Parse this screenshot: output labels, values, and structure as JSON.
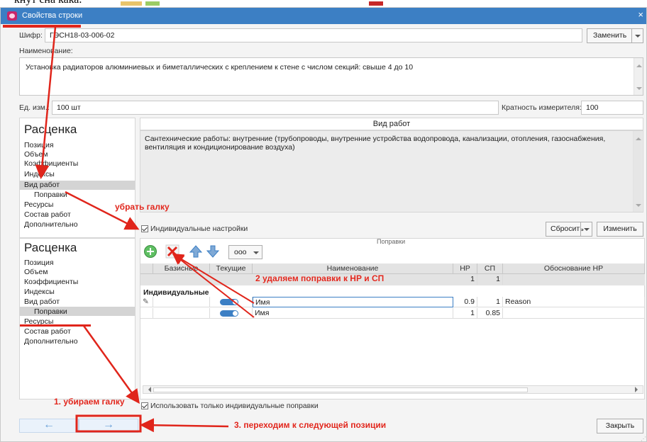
{
  "page_top_text": "кнут сна кака.",
  "window": {
    "title": "Свойства строки",
    "close_glyph": "×"
  },
  "code": {
    "label": "Шифр:",
    "value": "ГЭСН18-03-006-02",
    "replace_button": "Заменить"
  },
  "name": {
    "label": "Наименование:",
    "value": "Установка радиаторов алюминиевых и биметаллических с креплением к стене с числом секций: свыше 4 до 10"
  },
  "unit": {
    "label": "Ед. изм.:",
    "value": "100 шт",
    "multiplicity_label": "Кратность измерителя:",
    "multiplicity_value": "100"
  },
  "nav_top": {
    "title": "Расценка",
    "items": [
      "Позиция",
      "Объем",
      "Коэффициенты",
      "Индексы",
      "Вид работ",
      "Поправки",
      "Ресурсы",
      "Состав работ",
      "Дополнительно"
    ],
    "selected": "Вид работ"
  },
  "work_type": {
    "header": "Вид работ",
    "text": "Сантехнические работы: внутренние (трубопроводы, внутренние устройства водопровода, канализации, отопления, газоснабжения, вентиляция и кондиционирование воздуха)",
    "individual_settings_label": "Индивидуальные настройки",
    "reset_button": "Сбросить",
    "change_button": "Изменить"
  },
  "nav_bottom": {
    "title": "Расценка",
    "items": [
      "Позиция",
      "Объем",
      "Коэффициенты",
      "Индексы",
      "Вид работ",
      "Поправки",
      "Ресурсы",
      "Состав работ",
      "Дополнительно"
    ],
    "selected": "Поправки"
  },
  "corrections": {
    "header": "Поправки",
    "toolbar": {
      "more_label": "ооо"
    },
    "columns": [
      "Базисные",
      "Текущие",
      "Наименование",
      "НР",
      "СП",
      "Обоснование НР"
    ],
    "base_row": {
      "nr": "1",
      "sp": "1"
    },
    "group_label": "Индивидуальные",
    "rows": [
      {
        "name": "Имя",
        "nr": "0.9",
        "sp": "1",
        "reason": "Reason"
      },
      {
        "name": "Имя",
        "nr": "1",
        "sp": "0.85",
        "reason": ""
      }
    ],
    "only_individual_label": "Использовать только индивидуальные поправки"
  },
  "footer": {
    "prev_glyph": "←",
    "next_glyph": "→",
    "close_button": "Закрыть"
  },
  "annotations": {
    "uncheck": "убрать галку",
    "remove_corrections": "2 удаляем поправки к НР и СП",
    "step1": "1. убираем галку",
    "step3": "3. переходим к следующей позиции"
  },
  "colors": {
    "titlebar": "#3c7fc4",
    "accent_blue": "#3c7fc4",
    "annotation_red": "#e0251b",
    "add_green": "#4caf50",
    "delete_red": "#e0251b"
  }
}
